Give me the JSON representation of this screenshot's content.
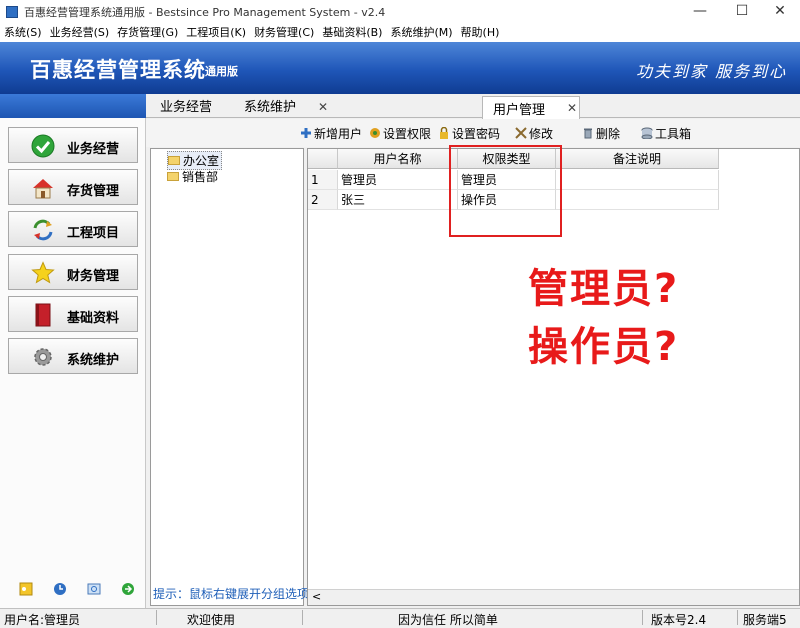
{
  "window": {
    "title": "百惠经营管理系统通用版 - Bestsince Pro Management System - v2.4",
    "controls": {
      "minimize": "—",
      "maximize": "☐",
      "close": "✕"
    }
  },
  "menu": [
    "系统(S)",
    "业务经营(S)",
    "存货管理(G)",
    "工程项目(K)",
    "财务管理(C)",
    "基础资料(B)",
    "系统维护(M)",
    "帮助(H)"
  ],
  "banner": {
    "title": "百惠经营管理系统",
    "edition": "通用版",
    "slogan": "功夫到家 服务到心"
  },
  "nav": [
    {
      "label": "业务经营",
      "icon": "check-circle-icon"
    },
    {
      "label": "存货管理",
      "icon": "house-icon"
    },
    {
      "label": "工程项目",
      "icon": "recycle-arrows-icon"
    },
    {
      "label": "财务管理",
      "icon": "star-icon"
    },
    {
      "label": "基础资料",
      "icon": "book-icon"
    },
    {
      "label": "系统维护",
      "icon": "gear-icon"
    }
  ],
  "tabs": [
    "业务经营",
    "系统维护",
    "用户管理"
  ],
  "toolbar": [
    "新增用户",
    "设置权限",
    "设置密码",
    "修改",
    "删除",
    "工具箱"
  ],
  "tree": {
    "nodes": [
      "办公室",
      "销售部"
    ],
    "hint": "提示：鼠标右键展开分组选项"
  },
  "grid": {
    "columns": [
      "用户名称",
      "权限类型",
      "备注说明"
    ],
    "rows": [
      {
        "no": "1",
        "name": "管理员",
        "role": "管理员",
        "note": ""
      },
      {
        "no": "2",
        "name": "张三",
        "role": "操作员",
        "note": ""
      }
    ],
    "scroll_left": "<"
  },
  "annotation": {
    "line1": "管理员?",
    "line2": "操作员?",
    "color": "#e81a1a"
  },
  "status": {
    "user": "用户名:管理员",
    "welcome": "欢迎使用",
    "motto": "因为信任 所以简单",
    "version": "版本号2.4",
    "service": "服务端5"
  },
  "colors": {
    "banner_blue": "#1f56b8",
    "hint_blue": "#1f5fb8"
  }
}
